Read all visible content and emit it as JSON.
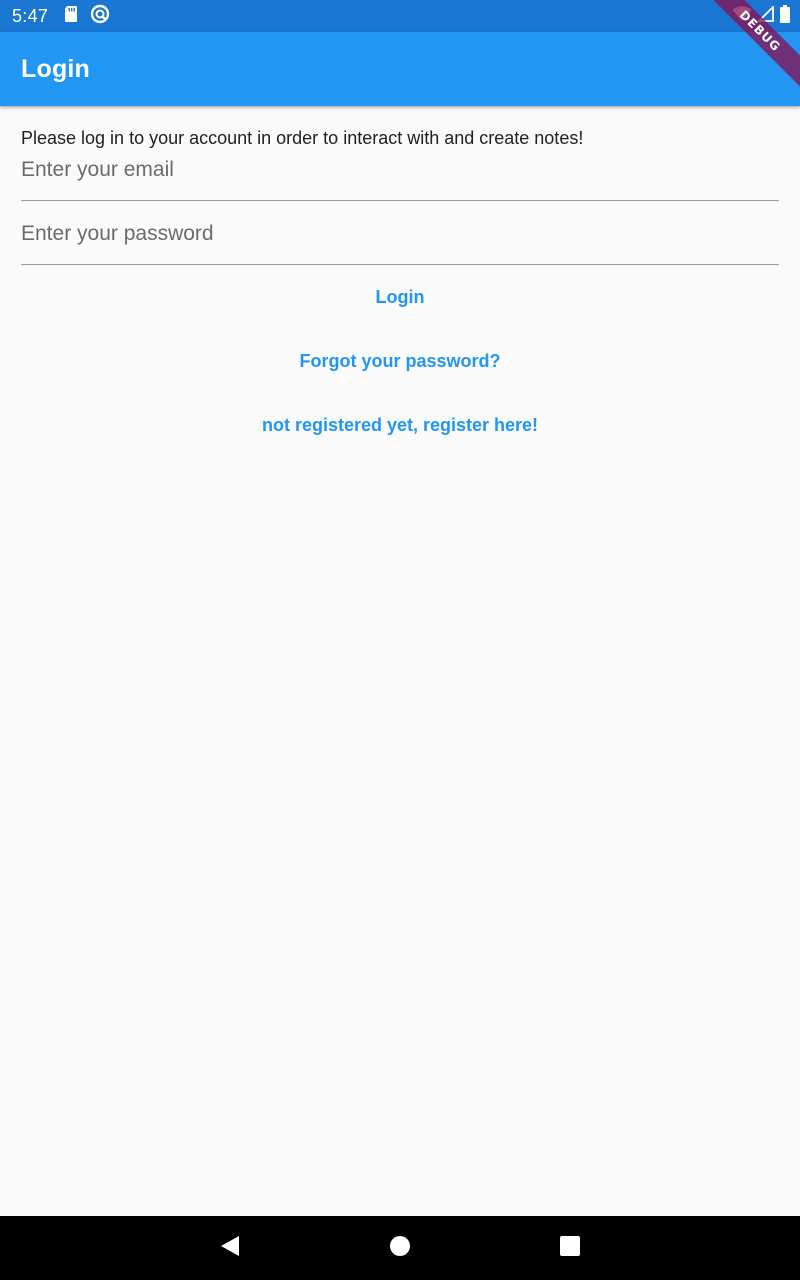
{
  "status_bar": {
    "time": "5:47",
    "left_icons": [
      "sd-card-icon",
      "sync-icon"
    ],
    "right_icons": [
      "wifi-icon",
      "signal-icon",
      "battery-icon"
    ]
  },
  "debug_banner": {
    "label": "DEBUG",
    "color": "#880e4f"
  },
  "app_bar": {
    "title": "Login",
    "color": "#2196f3"
  },
  "main": {
    "intro": "Please log in to your account in order to interact with and create notes!",
    "email_field": {
      "placeholder": "Enter your email",
      "value": ""
    },
    "password_field": {
      "placeholder": "Enter your password",
      "value": ""
    },
    "buttons": {
      "login": "Login",
      "forgot_password": "Forgot your password?",
      "register": "not registered yet, register here!"
    }
  },
  "nav_bar": {
    "buttons": [
      "back-icon",
      "home-icon",
      "recents-icon"
    ]
  },
  "colors": {
    "primary": "#2196f3",
    "status_bar": "#1976d2",
    "background": "#fafafa"
  }
}
